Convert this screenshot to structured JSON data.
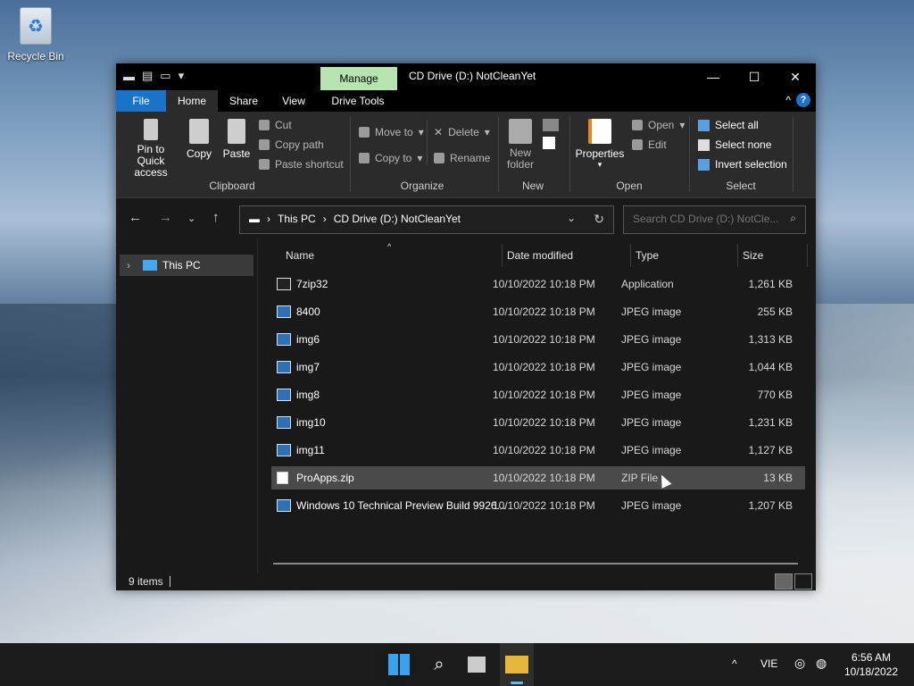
{
  "desktop": {
    "recycle_bin": "Recycle Bin"
  },
  "window": {
    "title": "CD Drive (D:) NotCleanYet",
    "manage_tab": "Manage",
    "controls": {
      "minimize": "—",
      "maximize": "☐",
      "close": "✕"
    }
  },
  "tabs": {
    "file": "File",
    "home": "Home",
    "share": "Share",
    "view": "View",
    "drive_tools": "Drive Tools"
  },
  "ribbon": {
    "pin": "Pin to Quick access",
    "copy": "Copy",
    "paste": "Paste",
    "cut": "Cut",
    "copy_path": "Copy path",
    "paste_shortcut": "Paste shortcut",
    "clipboard": "Clipboard",
    "move_to": "Move to",
    "copy_to": "Copy to",
    "delete": "Delete",
    "rename": "Rename",
    "organize": "Organize",
    "new_folder": "New folder",
    "new": "New",
    "properties": "Properties",
    "open": "Open",
    "edit": "Edit",
    "open_group": "Open",
    "select_all": "Select all",
    "select_none": "Select none",
    "invert_selection": "Invert selection",
    "select_group": "Select"
  },
  "address": {
    "this_pc": "This PC",
    "drive": "CD Drive (D:) NotCleanYet",
    "search_placeholder": "Search CD Drive (D:) NotCle..."
  },
  "nav": {
    "this_pc": "This PC"
  },
  "columns": {
    "name": "Name",
    "date": "Date modified",
    "type": "Type",
    "size": "Size"
  },
  "files": [
    {
      "name": "7zip32",
      "date": "10/10/2022 10:18 PM",
      "type": "Application",
      "size": "1,261 KB"
    },
    {
      "name": "8400",
      "date": "10/10/2022 10:18 PM",
      "type": "JPEG image",
      "size": "255 KB"
    },
    {
      "name": "img6",
      "date": "10/10/2022 10:18 PM",
      "type": "JPEG image",
      "size": "1,313 KB"
    },
    {
      "name": "img7",
      "date": "10/10/2022 10:18 PM",
      "type": "JPEG image",
      "size": "1,044 KB"
    },
    {
      "name": "img8",
      "date": "10/10/2022 10:18 PM",
      "type": "JPEG image",
      "size": "770 KB"
    },
    {
      "name": "img10",
      "date": "10/10/2022 10:18 PM",
      "type": "JPEG image",
      "size": "1,231 KB"
    },
    {
      "name": "img11",
      "date": "10/10/2022 10:18 PM",
      "type": "JPEG image",
      "size": "1,127 KB"
    },
    {
      "name": "ProApps.zip",
      "date": "10/10/2022 10:18 PM",
      "type": "ZIP File",
      "size": "13 KB"
    },
    {
      "name": "Windows 10 Technical Preview Build 9926...",
      "date": "10/10/2022 10:18 PM",
      "type": "JPEG image",
      "size": "1,207 KB"
    }
  ],
  "status": {
    "items": "9 items"
  },
  "taskbar": {
    "lang": "VIE",
    "time": "6:56 AM",
    "date": "10/18/2022"
  }
}
